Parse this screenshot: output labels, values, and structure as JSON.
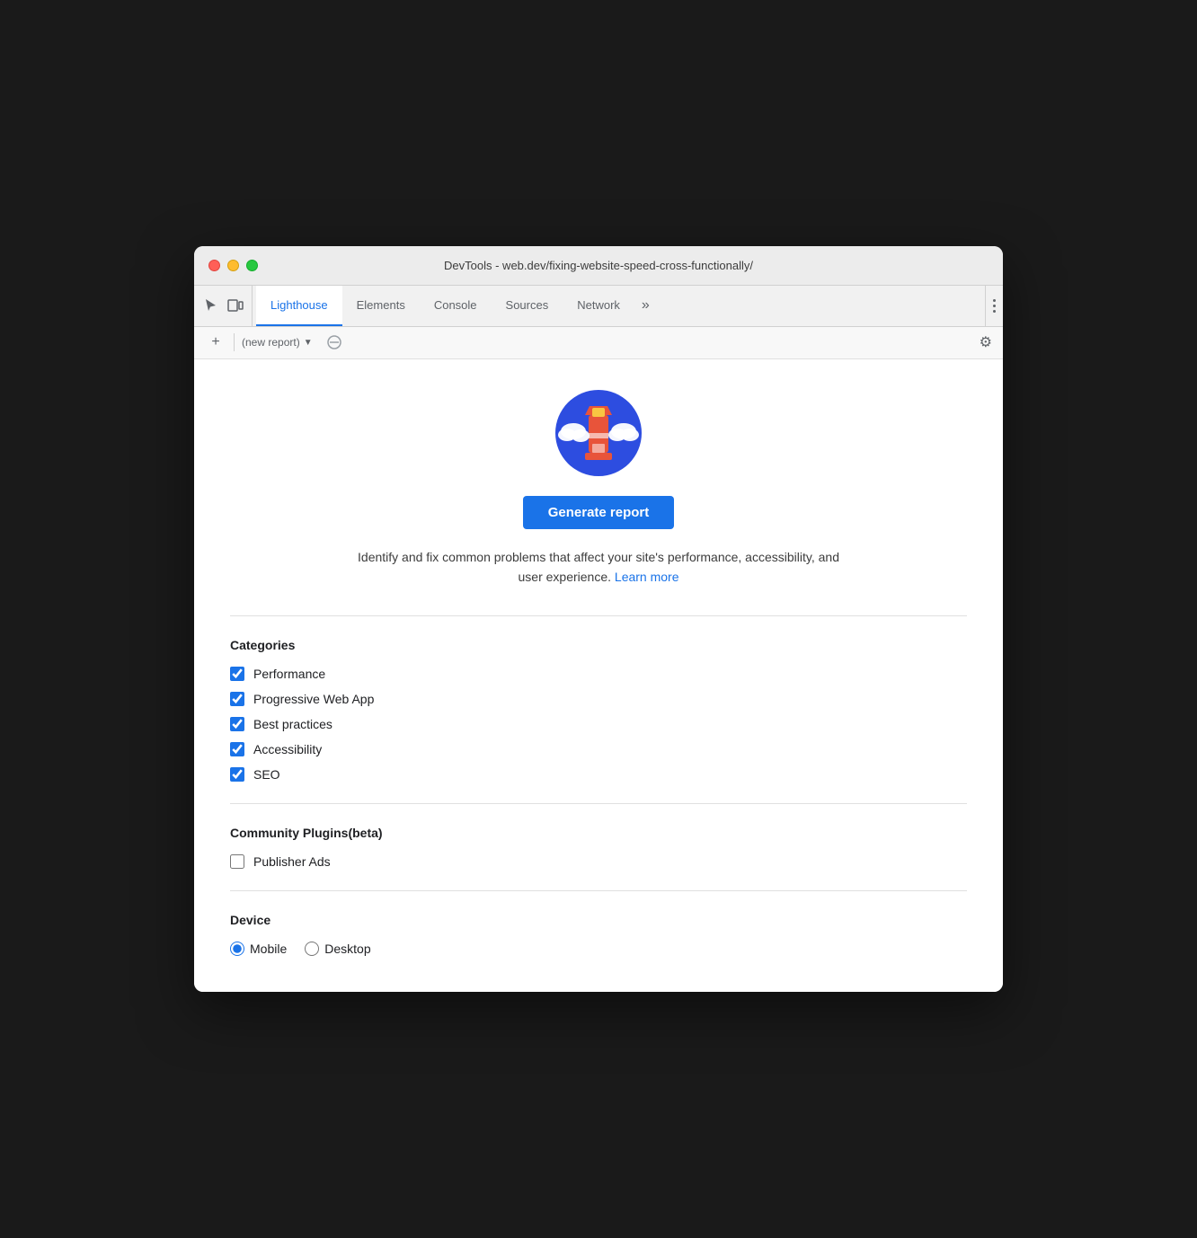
{
  "window": {
    "title": "DevTools - web.dev/fixing-website-speed-cross-functionally/"
  },
  "tabs": {
    "active": "Lighthouse",
    "items": [
      {
        "id": "lighthouse",
        "label": "Lighthouse"
      },
      {
        "id": "elements",
        "label": "Elements"
      },
      {
        "id": "console",
        "label": "Console"
      },
      {
        "id": "sources",
        "label": "Sources"
      },
      {
        "id": "network",
        "label": "Network"
      }
    ],
    "more_label": "»"
  },
  "toolbar": {
    "new_report_label": "(new report)",
    "add_icon": "+",
    "settings_icon": "⚙"
  },
  "hero": {
    "generate_btn_label": "Generate report",
    "description_text": "Identify and fix common problems that affect your site's performance, accessibility, and user experience.",
    "learn_more_label": "Learn more",
    "learn_more_href": "#"
  },
  "categories": {
    "title": "Categories",
    "items": [
      {
        "id": "performance",
        "label": "Performance",
        "checked": true
      },
      {
        "id": "pwa",
        "label": "Progressive Web App",
        "checked": true
      },
      {
        "id": "best-practices",
        "label": "Best practices",
        "checked": true
      },
      {
        "id": "accessibility",
        "label": "Accessibility",
        "checked": true
      },
      {
        "id": "seo",
        "label": "SEO",
        "checked": true
      }
    ]
  },
  "community_plugins": {
    "title": "Community Plugins(beta)",
    "items": [
      {
        "id": "publisher-ads",
        "label": "Publisher Ads",
        "checked": false
      }
    ]
  },
  "device": {
    "title": "Device",
    "options": [
      {
        "id": "mobile",
        "label": "Mobile",
        "selected": true
      },
      {
        "id": "desktop",
        "label": "Desktop",
        "selected": false
      }
    ]
  },
  "colors": {
    "accent": "#1a73e8",
    "tab_active_border": "#1a73e8"
  }
}
